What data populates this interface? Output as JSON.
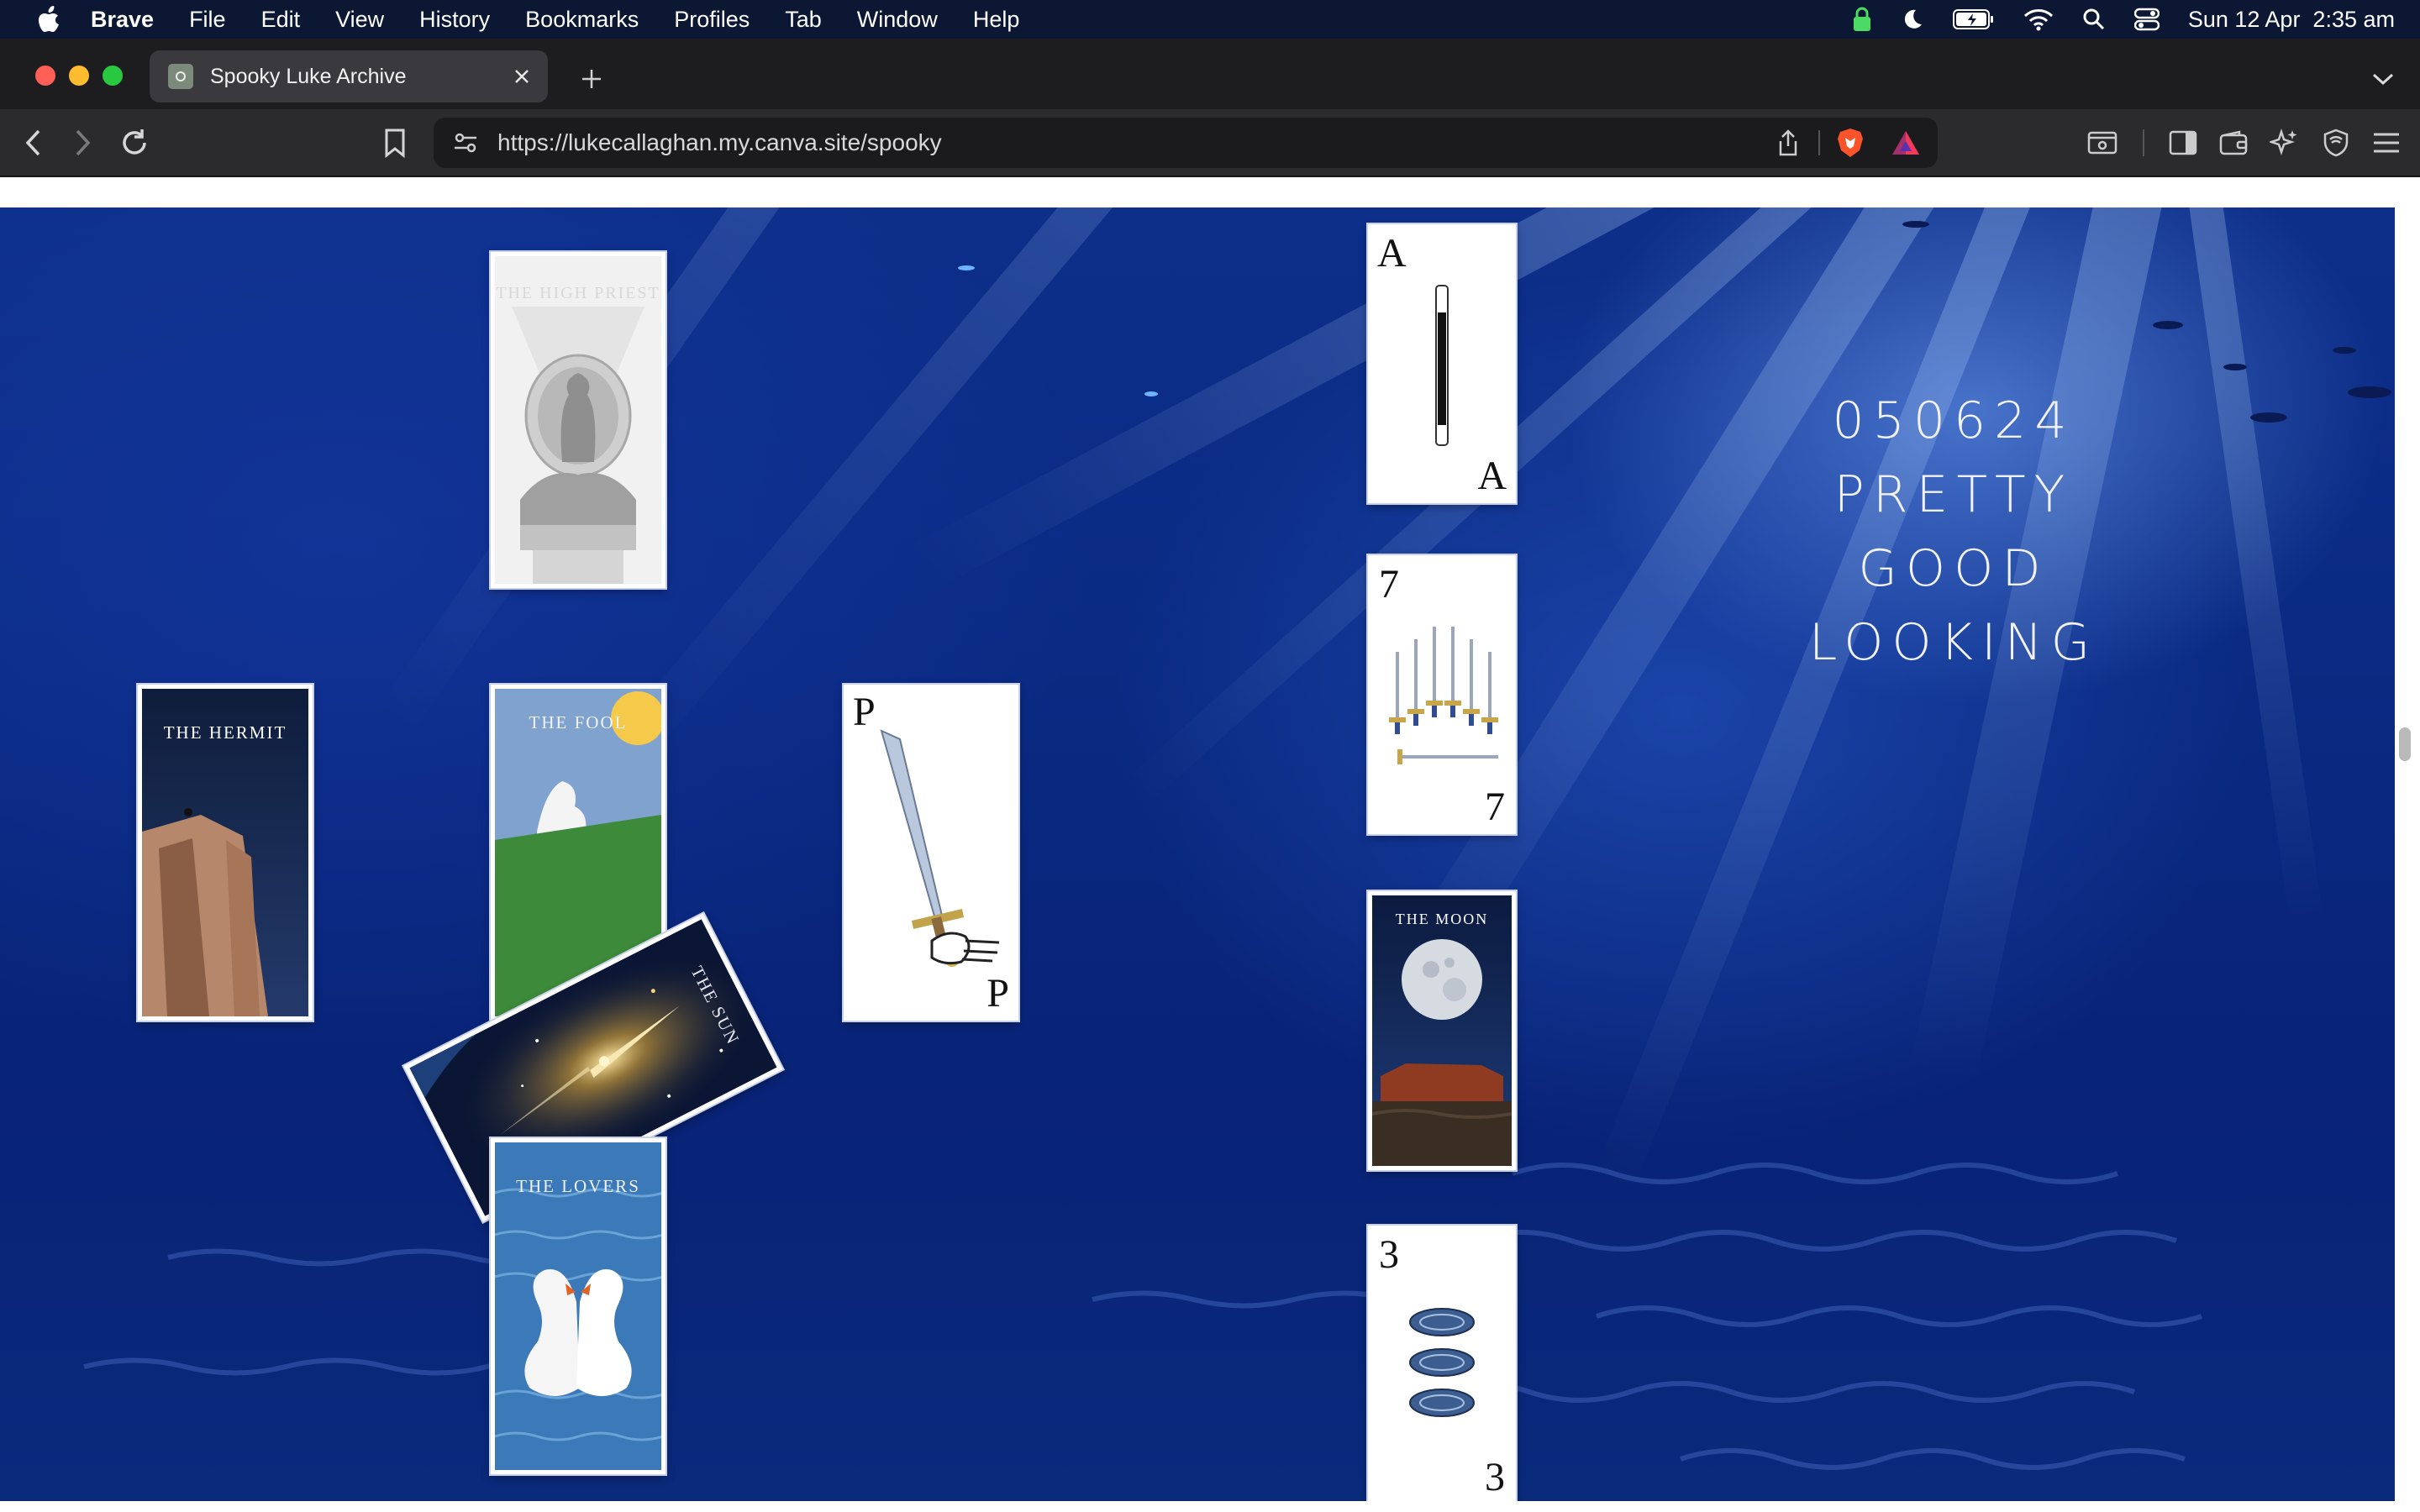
{
  "menubar": {
    "app": "Brave",
    "items": [
      "File",
      "Edit",
      "View",
      "History",
      "Bookmarks",
      "Profiles",
      "Tab",
      "Window",
      "Help"
    ],
    "clock": "Sun 12 Apr  2:35 am",
    "status_icons": [
      "lock-icon",
      "moon-icon",
      "battery-icon",
      "wifi-icon",
      "search-icon",
      "control-center-icon"
    ]
  },
  "tab": {
    "title": "Spooky Luke Archive"
  },
  "toolbar": {
    "url_host": "https://lukecallaghan.my.canva.site",
    "url_path": "/spooky"
  },
  "page": {
    "headline": [
      "050624",
      "PRETTY",
      "GOOD",
      "LOOKING"
    ],
    "cards": {
      "high_priest": "THE HIGH PRIEST",
      "hermit": "THE HERMIT",
      "fool": "THE FOOL",
      "sun": "THE SUN",
      "lovers": "THE LOVERS",
      "moon": "THE MOON",
      "ace": "A",
      "seven": "7",
      "page": "P",
      "three": "3"
    }
  },
  "colors": {
    "menubar_bg": "#0b1733",
    "ocean": "#0a2a83",
    "traffic_close": "#ff5f57",
    "traffic_min": "#febc2e",
    "traffic_max": "#28c840"
  }
}
